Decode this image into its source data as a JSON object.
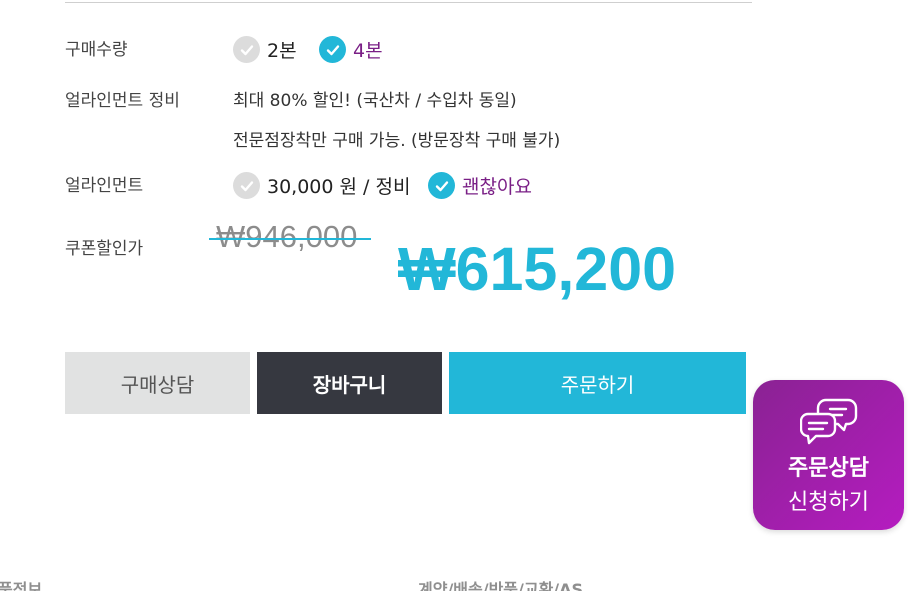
{
  "quantity": {
    "label": "구매수량",
    "options": [
      {
        "label": "2본",
        "selected": false
      },
      {
        "label": "4본",
        "selected": true
      }
    ]
  },
  "alignment_service": {
    "label": "얼라인먼트 정비",
    "line1": "최대 80% 할인!  (국산차 / 수입차 동일)",
    "line2": "전문점장착만 구매 가능. (방문장착 구매 불가)"
  },
  "alignment": {
    "label": "얼라인먼트",
    "options": [
      {
        "label": "30,000 원 / 정비",
        "selected": false
      },
      {
        "label": "괜찮아요",
        "selected": true
      }
    ]
  },
  "coupon": {
    "label": "쿠폰할인가",
    "original_price": "₩946,000",
    "sale_price": "₩615,200"
  },
  "buttons": {
    "consult": "구매상담",
    "cart": "장바구니",
    "order": "주문하기"
  },
  "floating_consult": {
    "line1": "주문상담",
    "line2": "신청하기"
  },
  "footer_tabs": {
    "product_info": "품정보",
    "policy": "계약/배송/반품/교환/AS"
  },
  "colors": {
    "accent": "#22b7d8",
    "selected_text": "#7a1f86",
    "cart_bg": "#363840",
    "consult_bg": "#e1e2e2",
    "float_gradient_start": "#8a2293",
    "float_gradient_end": "#b51cc0"
  },
  "icons": {
    "checkbox": "check-circle-icon",
    "chat": "chat-bubbles-icon"
  }
}
